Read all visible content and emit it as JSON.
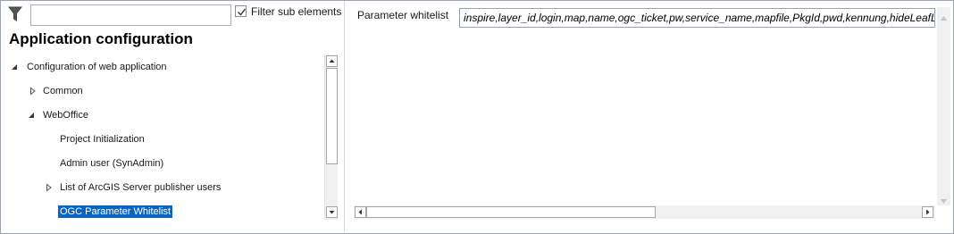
{
  "filter": {
    "search_value": "",
    "filter_sub_elements_label": "Filter sub elements",
    "filter_sub_elements_checked": true
  },
  "left_panel": {
    "title": "Application configuration"
  },
  "tree": {
    "items": [
      {
        "label": "Configuration of web application",
        "expander": "expanded"
      },
      {
        "label": "Common",
        "expander": "collapsed"
      },
      {
        "label": "WebOffice",
        "expander": "expanded"
      },
      {
        "label": "Project Initialization",
        "expander": "none"
      },
      {
        "label": "Admin user (SynAdmin)",
        "expander": "none"
      },
      {
        "label": "List of ArcGIS Server publisher users",
        "expander": "collapsed"
      },
      {
        "label": "OGC Parameter Whitelist",
        "expander": "none",
        "selected": true
      }
    ]
  },
  "properties": {
    "parameter_whitelist_label": "Parameter whitelist",
    "parameter_whitelist_value": "inspire,layer_id,login,map,name,ogc_ticket,pw,service_name,mapfile,PkgId,pwd,kennung,hideLeafLa"
  },
  "colors": {
    "selection": "#0a64c2",
    "border": "#9aa3ad",
    "scrollbar_track": "#f0f0f0"
  }
}
